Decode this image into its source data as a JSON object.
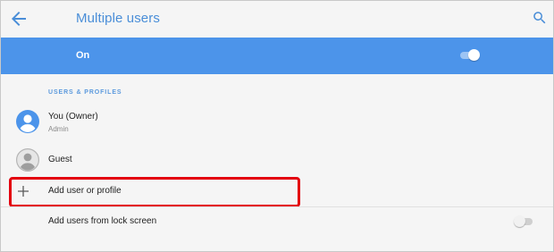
{
  "toolbar": {
    "title": "Multiple users",
    "back_icon": "arrow-left-icon",
    "search_icon": "search-icon"
  },
  "master_switch": {
    "label": "On",
    "state": "on"
  },
  "section": {
    "header": "USERS & PROFILES"
  },
  "users": [
    {
      "name": "You (Owner)",
      "subtitle": "Admin",
      "avatar_icon": "account-circle-icon"
    },
    {
      "name": "Guest",
      "subtitle": "",
      "avatar_icon": "guest-avatar-icon"
    }
  ],
  "add_user": {
    "label": "Add user or profile",
    "icon": "plus-icon"
  },
  "lock_screen": {
    "label": "Add users from lock screen",
    "state": "off"
  },
  "colors": {
    "accent": "#4c94ea",
    "title_blue": "#4a8ed8",
    "highlight_red": "#e3000d",
    "background": "#f5f5f5"
  }
}
